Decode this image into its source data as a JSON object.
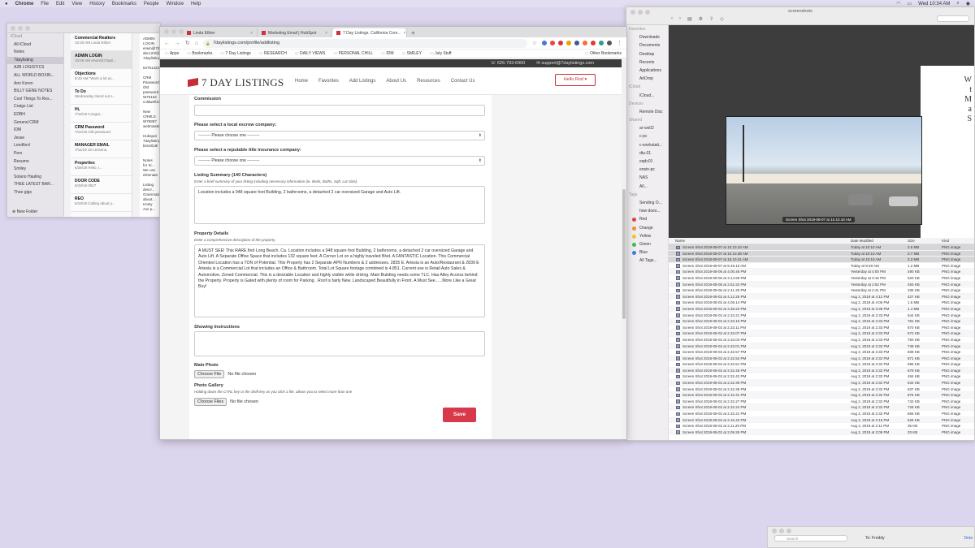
{
  "menubar": {
    "app": "Chrome",
    "items": [
      "File",
      "Edit",
      "View",
      "History",
      "Bookmarks",
      "People",
      "Window",
      "Help"
    ],
    "clock": "Wed 10:34 AM"
  },
  "notes": {
    "folders": [
      "iCloud",
      "All iCloud",
      "Notes",
      "7daylisting",
      "A2B LOGISTICS",
      "ALL WORLD BOXIN...",
      "Ann Koren",
      "BILLY GENE NOTES",
      "Cool Things To Res...",
      "Craigs List",
      "EDBH",
      "General CRM",
      "IDM",
      "Jesse",
      "Londford",
      "Pers",
      "Resume",
      "Smiley",
      "Solano Hauling",
      "THEE LATEST BAR...",
      "Thee gigs"
    ],
    "list": [
      {
        "title": "Commercial Realtors",
        "sub": "10:20 AM  Linda Ethier"
      },
      {
        "title": "ADMIN LOGIN",
        "sub": "10:06 AM  erwin@7dayli..."
      },
      {
        "title": "Objections",
        "sub": "8:43 AM  \"Work a lot wi..."
      },
      {
        "title": "To Do",
        "sub": "Wednesday  Send out s..."
      },
      {
        "title": "Hi,",
        "sub": "7/16/19  Congra..."
      },
      {
        "title": "CRM Password",
        "sub": "7/12/19  Old password"
      },
      {
        "title": "MANAGER EMAIL",
        "sub": "7/11/19  16 Lessons,"
      },
      {
        "title": "Properties",
        "sub": "6/28/19  Hello, I..."
      },
      {
        "title": "DOOR CODE",
        "sub": "6/28/19  0927"
      },
      {
        "title": "REO",
        "sub": "6/19/19  Calling about y..."
      }
    ],
    "body": "ADMIN LOGIN\nerwin@7daylisting.com\nabc123!@#\n7daylistings...\n\n547514237\n\nCRM Password\nOld password\nW76164\ncoldwell1986\n\nNew CRMLS\nW76867\nwebmaster6\n\nHubspot\n7daylistings\nbim2018!\n\n\nNotes for Si...\nWe can eliminate\n\nListing descr...\nGrammatica...\nabout...\nHosty Ave p...\n\nZillow\nRedfin\nTrilla",
    "new_folder": "New Folder"
  },
  "chrome": {
    "tabs": [
      {
        "label": "Linda Ethier",
        "active": false
      },
      {
        "label": "Marketing Email | HubSpot",
        "active": false
      },
      {
        "label": "7 Day Listings. California Com...",
        "active": true
      }
    ],
    "new_tab": "+",
    "url": "7daylistings.com/profile/addlisting",
    "bookmarks": [
      "Apps",
      "Bookmarks",
      "7 Day Listings",
      "RESEARCH",
      "DAILY VIEWS",
      "PERSONAL CHILL",
      "IDM",
      "SMILEY",
      "July Stuff"
    ],
    "other_bookmarks": "Other Bookmarks"
  },
  "site": {
    "phone": "☏ 626-793-6900",
    "email": "✉ support@7daylistings.com",
    "logo": "7 DAY LISTINGS",
    "nav": [
      "Home",
      "Favorites",
      "Add Listings",
      "About Us",
      "Resources",
      "Contact Us"
    ],
    "hello": "Hello Rod ▾"
  },
  "form": {
    "commission_label": "Commission",
    "escrow_label": "Please select a local escrow company:",
    "escrow_value": "--------- Please choose one ---------",
    "title_label": "Please select a reputable title insurance company:",
    "title_value": "--------- Please choose one ---------",
    "summary_label": "Listing Summary (140 Characters)",
    "summary_hint": "Enter a brief summary of your listing including necessary information (ie. Beds, Baths, Sqft, Lot Size).",
    "summary_value": "Location includes a 948 square foot Building, 2 bathrooms, a detached 2 car oversized Garage and Auto Lift.",
    "details_label": "Property Details",
    "details_hint": "Enter a comprehensive description of the property.",
    "details_value": "A MUST SEE! This RARE find Long Beach, Ca. Location includes a 948 square foot Building, 2 bathrooms, a detached 2 car oversized Garage and Auto Lift. A Separate Office Space that includes 132 square feet. A Corner Lot on a highly traveled Blvd. A FANTASTIC Location. This Commercial Oriented Location has a TON of Potential. This Property has 2 Separate APN Numbers & 2 addresses. 2835 E. Artesia is an Auto/Restaurant & 2839 E Artesia is a Commercial Lot that includes an Office & Bathroom. Total Lot Square footage combined is 4,851. Current use is Retail Auto Sales & Automotive. Zoned Commercial. This is a desirable Location and highly visible while driving. Main Building needs some TLC. Has Alley Access behind the Property. Property is Gated with plenty of room for Parking . Roof is fairly New. Landscaped Beautifully in Front. A Must See......More Like a Great Buy!",
    "showing_label": "Showing Instructions",
    "photo_label": "Main Photo",
    "choose_file": "Choose File",
    "no_file": "No file chosen",
    "gallery_label": "Photo Gallery",
    "gallery_hint": "Holding down the CTRL key or the Shift key as you click a file, allows you to select more than one",
    "choose_files": "Choose Files",
    "save": "Save"
  },
  "finder": {
    "title": "screenshots",
    "sidebar": [
      {
        "label": "Favorites",
        "hdr": true
      },
      {
        "label": "Downloads"
      },
      {
        "label": "Documents"
      },
      {
        "label": "Desktop"
      },
      {
        "label": "Recents"
      },
      {
        "label": "Applications"
      },
      {
        "label": "AirDrop"
      },
      {
        "label": "iCloud",
        "hdr": true
      },
      {
        "label": "iCloud..."
      },
      {
        "label": "Devices",
        "hdr": true
      },
      {
        "label": "Remote Disc"
      },
      {
        "label": "Shared",
        "hdr": true
      },
      {
        "label": "ar-ws02"
      },
      {
        "label": "c-pc"
      },
      {
        "label": "c-workstati..."
      },
      {
        "label": "dtu-01"
      },
      {
        "label": "eqdc01"
      },
      {
        "label": "erwin-pc"
      },
      {
        "label": "NAS"
      },
      {
        "label": "All..."
      },
      {
        "label": "Tags",
        "hdr": true
      },
      {
        "label": "Sending O..."
      },
      {
        "label": "how does..."
      },
      {
        "label": "Red",
        "color": "#e0443e"
      },
      {
        "label": "Orange",
        "color": "#f0962e"
      },
      {
        "label": "Yellow",
        "color": "#f2c830"
      },
      {
        "label": "Green",
        "color": "#3fbf4a"
      },
      {
        "label": "Blue",
        "color": "#3a7ff0"
      },
      {
        "label": "All Tags..."
      }
    ],
    "preview_caption": "Screen Shot 2019-08-07 at 10.10.43 AM",
    "preview_side_text": [
      "W",
      "t",
      "M",
      "a",
      "S"
    ],
    "columns": [
      "Name",
      "Date Modified",
      "Size",
      "Kind"
    ],
    "rows": [
      [
        "Screen Shot 2019-08-07 at 10.10.43 AM",
        "Today at 10:10 AM",
        "3.6 MB",
        "PNG image"
      ],
      [
        "Screen Shot 2019-08-07 at 10.10.38 AM",
        "Today at 10:10 AM",
        "2.7 MB",
        "PNG image"
      ],
      [
        "Screen Shot 2019-08-07 at 10.10.31 AM",
        "Today at 10:10 AM",
        "3.3 MB",
        "PNG image"
      ],
      [
        "Screen Shot 2019-08-07 at 9.49.10 AM",
        "Today at 9:49 AM",
        "1.2 MB",
        "PNG image"
      ],
      [
        "Screen Shot 2019-08-06 at 4.00.46 PM",
        "Yesterday at 4:00 PM",
        "490 KB",
        "PNG image"
      ],
      [
        "Screen Shot 2019-08-06 at 3.14.59 PM",
        "Yesterday at 3:15 PM",
        "520 KB",
        "PNG image"
      ],
      [
        "Screen Shot 2019-08-06 at 2.52.32 PM",
        "Yesterday at 2:52 PM",
        "493 KB",
        "PNG image"
      ],
      [
        "Screen Shot 2019-08-06 at 2.41.33 PM",
        "Yesterday at 2:41 PM",
        "335 KB",
        "PNG image"
      ],
      [
        "Screen Shot 2019-08-02 at 4.12.25 PM",
        "Aug 2, 2019 at 4:12 PM",
        "427 KB",
        "PNG image"
      ],
      [
        "Screen Shot 2019-08-02 at 4.06.14 PM",
        "Aug 2, 2019 at 4:06 PM",
        "1.6 MB",
        "PNG image"
      ],
      [
        "Screen Shot 2019-08-02 at 3.38.23 PM",
        "Aug 2, 2019 at 3:38 PM",
        "1.4 MB",
        "PNG image"
      ],
      [
        "Screen Shot 2019-08-02 at 2.33.21 PM",
        "Aug 2, 2019 at 2:33 PM",
        "644 KB",
        "PNG image"
      ],
      [
        "Screen Shot 2019-08-02 at 2.33.15 PM",
        "Aug 2, 2019 at 2:33 PM",
        "781 KB",
        "PNG image"
      ],
      [
        "Screen Shot 2019-08-02 at 2.33.11 PM",
        "Aug 2, 2019 at 2:33 PM",
        "870 KB",
        "PNG image"
      ],
      [
        "Screen Shot 2019-08-02 at 2.33.07 PM",
        "Aug 2, 2019 at 2:33 PM",
        "672 KB",
        "PNG image"
      ],
      [
        "Screen Shot 2019-08-02 at 2.33.04 PM",
        "Aug 2, 2019 at 2:33 PM",
        "760 KB",
        "PNG image"
      ],
      [
        "Screen Shot 2019-08-02 at 2.33.01 PM",
        "Aug 2, 2019 at 2:33 PM",
        "748 KB",
        "PNG image"
      ],
      [
        "Screen Shot 2019-08-02 at 2.32.57 PM",
        "Aug 2, 2019 at 2:33 PM",
        "608 KB",
        "PNG image"
      ],
      [
        "Screen Shot 2019-08-02 at 2.32.54 PM",
        "Aug 2, 2019 at 2:32 PM",
        "871 KB",
        "PNG image"
      ],
      [
        "Screen Shot 2019-08-02 at 2.32.51 PM",
        "Aug 2, 2019 at 2:32 PM",
        "695 KB",
        "PNG image"
      ],
      [
        "Screen Shot 2019-08-02 at 2.32.45 PM",
        "Aug 2, 2019 at 2:32 PM",
        "679 KB",
        "PNG image"
      ],
      [
        "Screen Shot 2019-08-02 at 2.32.42 PM",
        "Aug 2, 2019 at 2:32 PM",
        "484 KB",
        "PNG image"
      ],
      [
        "Screen Shot 2019-08-02 at 2.32.39 PM",
        "Aug 2, 2019 at 2:32 PM",
        "534 KB",
        "PNG image"
      ],
      [
        "Screen Shot 2019-08-02 at 2.32.36 PM",
        "Aug 2, 2019 at 2:32 PM",
        "637 KB",
        "PNG image"
      ],
      [
        "Screen Shot 2019-08-02 at 2.32.31 PM",
        "Aug 2, 2019 at 2:32 PM",
        "876 KB",
        "PNG image"
      ],
      [
        "Screen Shot 2019-08-02 at 2.32.27 PM",
        "Aug 2, 2019 at 2:32 PM",
        "742 KB",
        "PNG image"
      ],
      [
        "Screen Shot 2019-08-02 at 2.32.24 PM",
        "Aug 2, 2019 at 2:32 PM",
        "728 KB",
        "PNG image"
      ],
      [
        "Screen Shot 2019-08-02 at 2.32.21 PM",
        "Aug 2, 2019 at 2:32 PM",
        "665 KB",
        "PNG image"
      ],
      [
        "Screen Shot 2019-08-02 at 2.15.43 PM",
        "Aug 2, 2019 at 2:15 PM",
        "628 KB",
        "PNG image"
      ],
      [
        "Screen Shot 2019-08-02 at 2.11.20 PM",
        "Aug 2, 2019 at 2:11 PM",
        "35 KB",
        "PNG image"
      ],
      [
        "Screen Shot 2019-08-02 at 2.09.26 PM",
        "Aug 2, 2019 at 2:09 PM",
        "33 KB",
        "PNG image"
      ]
    ]
  },
  "mail": {
    "search": "Search",
    "to": "To:  Freddy",
    "details": "Deta"
  }
}
